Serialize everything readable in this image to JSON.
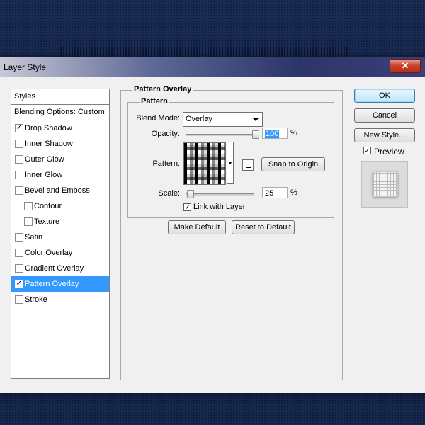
{
  "window": {
    "title": "Layer Style",
    "close_label": "✕"
  },
  "styles_panel": {
    "header": "Styles",
    "blending": "Blending Options: Custom",
    "items": [
      {
        "label": "Drop Shadow",
        "checked": true,
        "indent": false,
        "selected": false
      },
      {
        "label": "Inner Shadow",
        "checked": false,
        "indent": false,
        "selected": false
      },
      {
        "label": "Outer Glow",
        "checked": false,
        "indent": false,
        "selected": false
      },
      {
        "label": "Inner Glow",
        "checked": false,
        "indent": false,
        "selected": false
      },
      {
        "label": "Bevel and Emboss",
        "checked": false,
        "indent": false,
        "selected": false
      },
      {
        "label": "Contour",
        "checked": false,
        "indent": true,
        "selected": false
      },
      {
        "label": "Texture",
        "checked": false,
        "indent": true,
        "selected": false
      },
      {
        "label": "Satin",
        "checked": false,
        "indent": false,
        "selected": false
      },
      {
        "label": "Color Overlay",
        "checked": false,
        "indent": false,
        "selected": false
      },
      {
        "label": "Gradient Overlay",
        "checked": false,
        "indent": false,
        "selected": false
      },
      {
        "label": "Pattern Overlay",
        "checked": true,
        "indent": false,
        "selected": true
      },
      {
        "label": "Stroke",
        "checked": false,
        "indent": false,
        "selected": false
      }
    ]
  },
  "pattern_overlay": {
    "group_title": "Pattern Overlay",
    "section_title": "Pattern",
    "blend_mode_label": "Blend Mode:",
    "blend_mode_value": "Overlay",
    "opacity_label": "Opacity:",
    "opacity_value": "100",
    "opacity_unit": "%",
    "opacity_percent": 100,
    "pattern_label": "Pattern:",
    "snap_button": "Snap to Origin",
    "scale_label": "Scale:",
    "scale_value": "25",
    "scale_unit": "%",
    "scale_percent": 25,
    "link_label": "Link with Layer",
    "link_checked": true,
    "make_default": "Make Default",
    "reset_default": "Reset to Default"
  },
  "right_panel": {
    "ok": "OK",
    "cancel": "Cancel",
    "new_style": "New Style...",
    "preview_label": "Preview",
    "preview_checked": true
  },
  "colors": {
    "selection": "#3399ff",
    "close": "#c8402c"
  }
}
